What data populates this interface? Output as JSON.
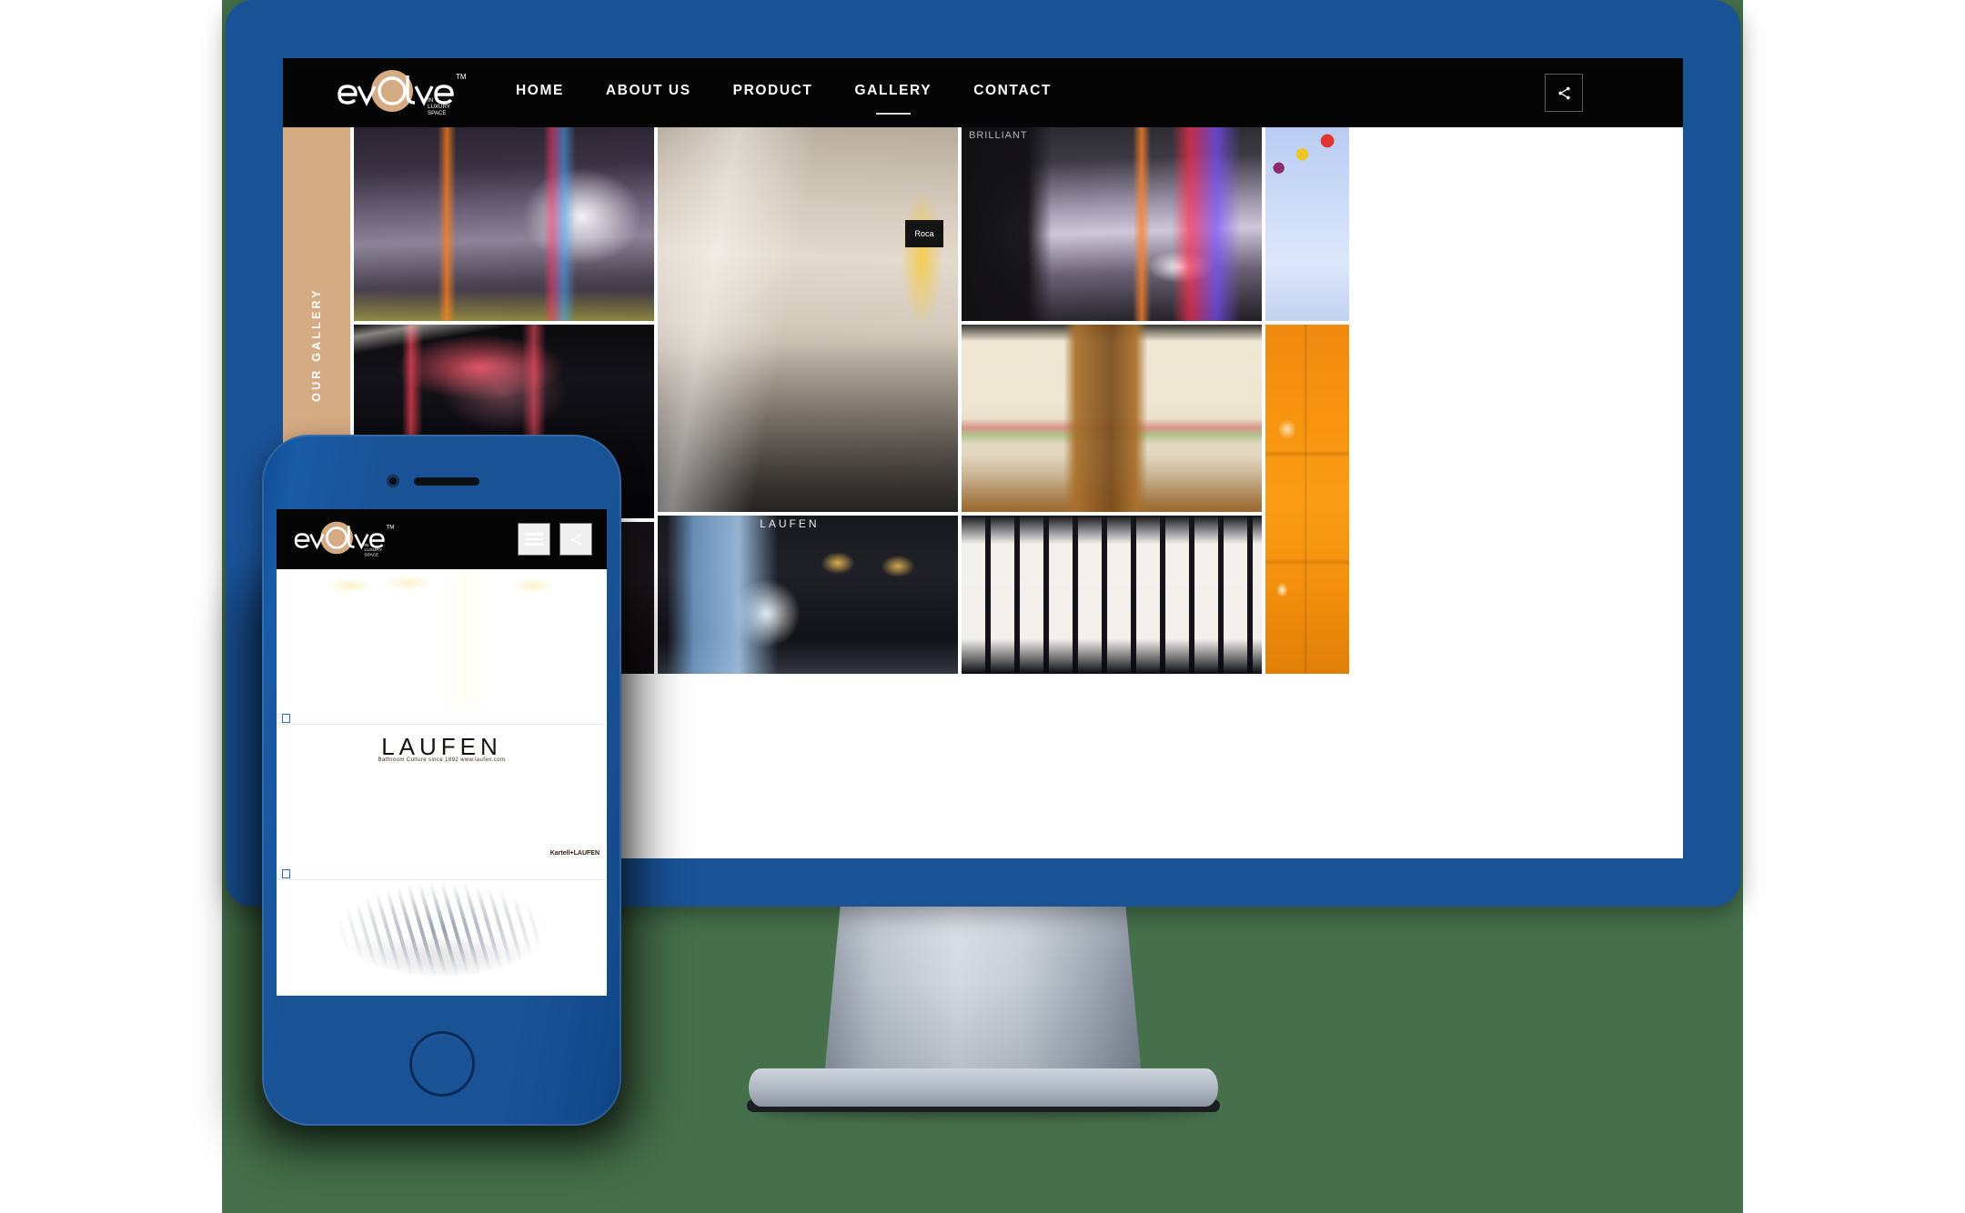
{
  "palette": {
    "backdrop_green": "#46704b",
    "device_blue": "#1a5296",
    "header_black": "#050505",
    "side_tan": "#d5ab83",
    "page_white": "#ffffff",
    "accent_orange": "#f7930f"
  },
  "site": {
    "logo": {
      "wordmark": "evolve",
      "tm": "TM",
      "tagline_line1": "IN",
      "tagline_line2": "LUXURY",
      "tagline_line3": "SPACE"
    },
    "nav": [
      {
        "label": "HOME",
        "active": false
      },
      {
        "label": "ABOUT US",
        "active": false
      },
      {
        "label": "PRODUCT",
        "active": false
      },
      {
        "label": "GALLERY",
        "active": true
      },
      {
        "label": "CONTACT",
        "active": false
      }
    ],
    "header_action": {
      "icon": "share-icon",
      "label": ""
    },
    "section_label": "OUR GALLERY"
  },
  "gallery": {
    "items": [
      {
        "alt": "Violet lit bathroom showroom display",
        "style": "ph-showroom-violet"
      },
      {
        "alt": "Dark showroom with red LED rain shower ceiling",
        "style": "ph-dark-shower"
      },
      {
        "alt": "Warm lit bathroom vanity with mirror",
        "style": "ph-bath-warm"
      },
      {
        "alt": "Row of sanitaryware on display ledge",
        "style": "ph-sanitary-row"
      },
      {
        "alt": "Gold chandelier lamps on display",
        "style": "ph-chandelier"
      },
      {
        "alt": "BRILLIANT showroom wall with vessel basin",
        "style": "ph-brilliant"
      },
      {
        "alt": "Tiled bathroom with wood strip feature wall",
        "style": "ph-tile-wood"
      },
      {
        "alt": "LAUFEN bathroom display room",
        "style": "ph-laufen-dark"
      },
      {
        "alt": "Wall of faucets and showers display",
        "style": "ph-faucet-wall"
      },
      {
        "alt": "Blue lit shower head display wall",
        "style": "ph-blue-fittings"
      },
      {
        "alt": "Orange glossy tiled wall display",
        "style": "ph-orange"
      }
    ],
    "image_labels": {
      "roca": "Roca",
      "brilliant": "BRILLIANT",
      "laufen": "LAUFEN",
      "kartell_laufen": "Kartell+LAUFEN"
    }
  },
  "phone": {
    "menu_icon": "hamburger-icon",
    "share_icon": "share-icon",
    "items": [
      {
        "alt": "Warm lit bathroom vanity with twin basins",
        "style": "ph-mirror-bath",
        "has_bar": false
      },
      {
        "alt": "LAUFEN orange showroom booth",
        "style": "ph-laufen-orange",
        "has_bar": true,
        "brand": "LAUFEN",
        "brand_sub": "Bathroom Culture since 1892   www.laufen.com"
      },
      {
        "alt": "Showroom ceiling panel display",
        "style": "ph-ceiling-panel",
        "has_bar": true
      }
    ]
  }
}
